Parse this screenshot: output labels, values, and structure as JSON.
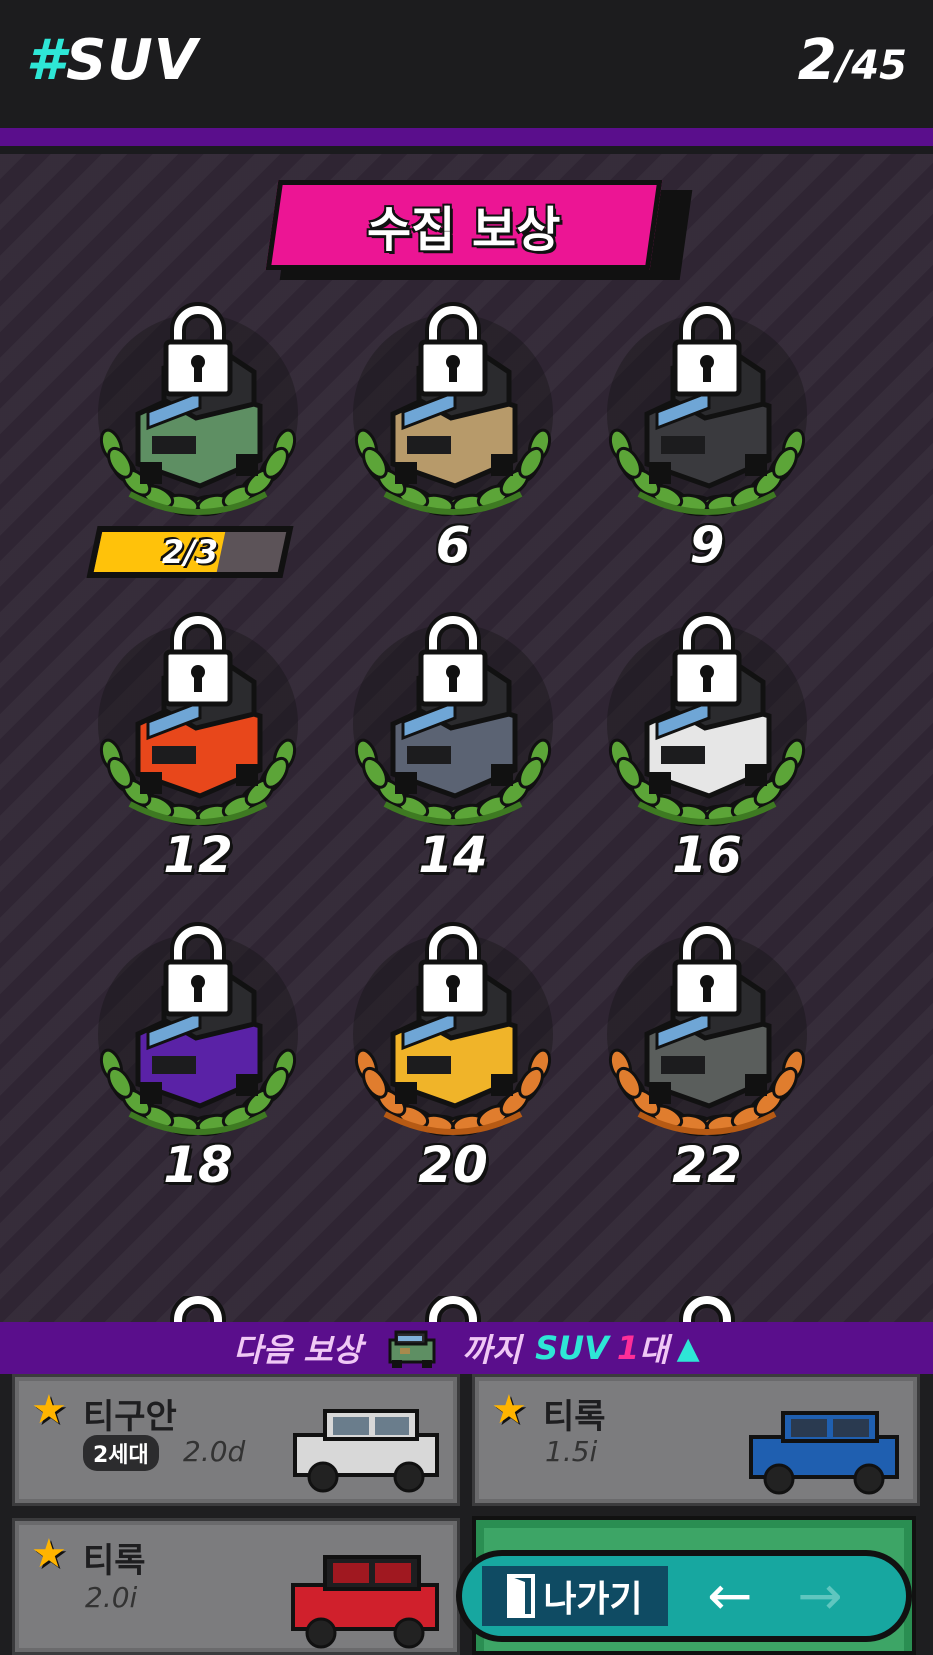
{
  "header": {
    "hash": "#",
    "category": "SUV",
    "collected": "2",
    "total": "/45"
  },
  "banner": {
    "title": "수집 보상"
  },
  "rewards": [
    {
      "label": "",
      "progress_text": "2/3",
      "progress": 0.667,
      "locked": true,
      "wreath": "green",
      "car_color": "#5e8f63"
    },
    {
      "label": "6",
      "locked": true,
      "wreath": "green",
      "car_color": "#b79a6a"
    },
    {
      "label": "9",
      "locked": true,
      "wreath": "green",
      "car_color": "#3a3a3e"
    },
    {
      "label": "12",
      "locked": true,
      "wreath": "green",
      "car_color": "#e8471b"
    },
    {
      "label": "14",
      "locked": true,
      "wreath": "green",
      "car_color": "#5b6373"
    },
    {
      "label": "16",
      "locked": true,
      "wreath": "green",
      "car_color": "#e6e6e6"
    },
    {
      "label": "18",
      "locked": true,
      "wreath": "green",
      "car_color": "#5a22a6"
    },
    {
      "label": "20",
      "locked": true,
      "wreath": "bronze",
      "car_color": "#f0b429"
    },
    {
      "label": "22",
      "locked": true,
      "wreath": "bronze",
      "car_color": "#5a5e5c"
    }
  ],
  "next_reward": {
    "prefix": "다음 보상",
    "until": "까지",
    "category": "SUV",
    "count": "1",
    "unit": "대",
    "icon": "chevron-up-icon"
  },
  "cards": [
    {
      "name": "티구안",
      "generation": "2세대",
      "trim": "2.0d",
      "car_color": "#d8d8d8"
    },
    {
      "name": "티록",
      "trim": "1.5i",
      "car_color": "#1f5fb0"
    },
    {
      "name": "티록",
      "trim": "2.0i",
      "car_color": "#d0202c"
    }
  ],
  "footer": {
    "exit_label": "나가기",
    "prev_icon": "arrow-left-icon",
    "next_icon": "arrow-right-icon"
  },
  "colors": {
    "accent_cyan": "#2ee6d6",
    "accent_pink": "#ec1594",
    "purple": "#5a0e8c",
    "progress_fill": "#ffc20a"
  }
}
